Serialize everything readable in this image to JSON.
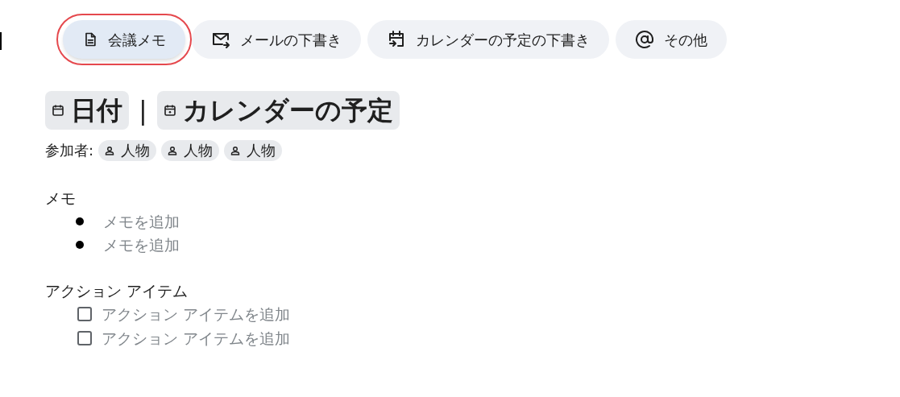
{
  "templates": [
    {
      "kind": "doc",
      "label": "会議メモ",
      "selected": true
    },
    {
      "kind": "mail",
      "label": "メールの下書き",
      "selected": false
    },
    {
      "kind": "event",
      "label": "カレンダーの予定の下書き",
      "selected": false
    },
    {
      "kind": "at",
      "label": "その他",
      "selected": false
    }
  ],
  "heading": {
    "date": "日付",
    "separator": "|",
    "event": "カレンダーの予定"
  },
  "attendees": {
    "label": "参加者:",
    "people": [
      "人物",
      "人物",
      "人物"
    ]
  },
  "notes": {
    "title": "メモ",
    "items": [
      {
        "placeholder": "メモを追加"
      },
      {
        "placeholder": "メモを追加"
      }
    ]
  },
  "actions": {
    "title": "アクション アイテム",
    "items": [
      {
        "placeholder": "アクション アイテムを追加",
        "checked": false
      },
      {
        "placeholder": "アクション アイテムを追加",
        "checked": false
      }
    ]
  }
}
